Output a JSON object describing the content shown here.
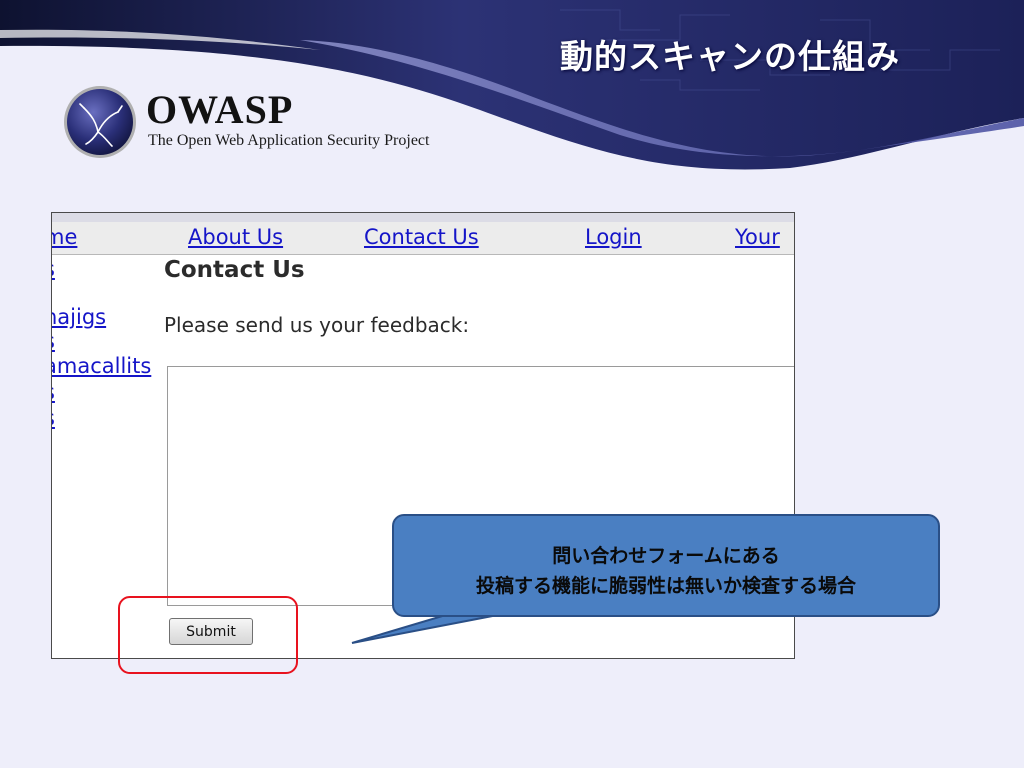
{
  "slide": {
    "title": "動的スキャンの仕組み"
  },
  "logo": {
    "name": "OWASP",
    "tagline": "The Open Web Application Security Project"
  },
  "browser": {
    "nav": {
      "items": [
        "me",
        "About Us",
        "Contact Us",
        "Login",
        "Your"
      ]
    },
    "sidebar": {
      "items": [
        "s",
        "najigs",
        "s",
        "amacallits",
        "s",
        "s"
      ]
    },
    "content": {
      "title": "Contact Us",
      "prompt": "Please send us your feedback:",
      "feedback_value": "",
      "submit_label": "Submit"
    }
  },
  "callout": {
    "lines": [
      "問い合わせフォームにある",
      "投稿する機能に脆弱性は無いか検査する場合"
    ]
  },
  "colors": {
    "slide_background": "#eeeefa",
    "header_dark": "#1b1f4f",
    "link": "#1515c8",
    "callout_fill": "#4a7fc2",
    "highlight_border": "#e8121e"
  }
}
